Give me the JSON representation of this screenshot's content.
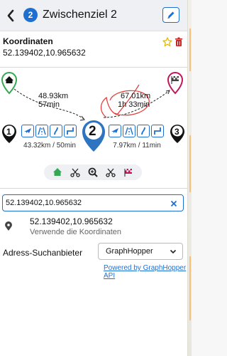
{
  "header": {
    "back_icon": "chevron-left-icon",
    "badge_number": "2",
    "title": "Zwischenziel 2",
    "edit_icon": "pencil-icon"
  },
  "coordinates": {
    "label": "Koordinaten",
    "value": "52.139402,10.965632",
    "favorite_icon": "star-icon",
    "delete_icon": "trash-icon"
  },
  "route": {
    "start_marker": "home-icon",
    "end_marker": "flag-icon",
    "left_segment": {
      "distance": "48.93km",
      "duration": "57min"
    },
    "right_segment": {
      "distance": "67.01km",
      "duration": "1h 33min"
    },
    "left_point_number": "1",
    "current_point_number": "2",
    "right_point_number": "3",
    "left_leg_summary": "43.32km / 50min",
    "right_leg_summary": "7.97km / 11min",
    "left_modes": [
      "plane-icon",
      "motorway-icon",
      "road-icon",
      "route-icon"
    ],
    "right_modes": [
      "plane-icon",
      "motorway-icon",
      "road-icon",
      "route-icon"
    ],
    "tools": [
      "home-icon",
      "scissors-icon",
      "zoom-icon",
      "scissors-icon",
      "flag-icon"
    ]
  },
  "search": {
    "value": "52.139402,10.965632",
    "clear_icon": "close-icon"
  },
  "suggestion": {
    "icon": "map-pin-icon",
    "title": "52.139402,10.965632",
    "subtitle": "Verwende die Koordinaten"
  },
  "provider": {
    "label": "Adress-Suchanbieter",
    "selected": "GraphHopper",
    "link": "Powered by GraphHopper API"
  },
  "colors": {
    "accent": "#1e6fd1",
    "start_green": "#34a853",
    "end_pink": "#c2185b",
    "favorite_yellow": "#e6b800",
    "delete_red": "#c62828",
    "annotation_red": "#e53935"
  }
}
